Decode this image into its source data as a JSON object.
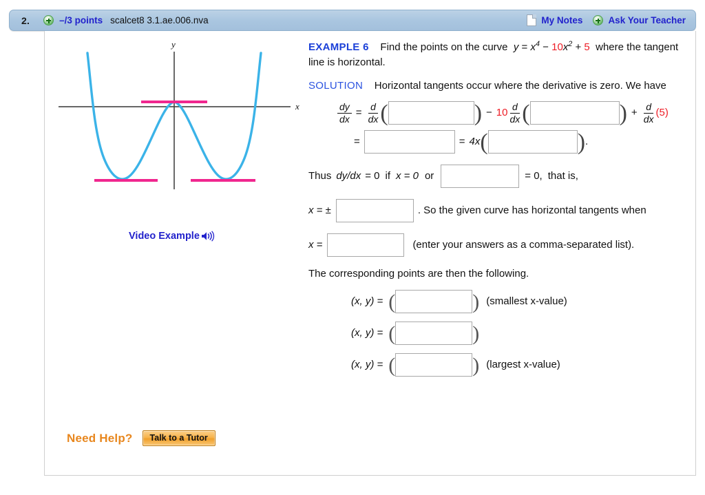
{
  "header": {
    "question_number": "2.",
    "add_icon": "plus-circle-icon",
    "points": "–/3 points",
    "assignment_id": "scalcet8 3.1.ae.006.nva",
    "notes_icon": "note-page-icon",
    "notes_label": "My Notes",
    "teacher_icon": "plus-circle-icon",
    "teacher_label": "Ask Your Teacher"
  },
  "graph": {
    "y_axis_label": "y",
    "x_axis_label": "x",
    "curve_color": "#3BB3E8",
    "tangent_color": "#F0278F",
    "axis_color": "#333333",
    "video_example_label": "Video Example",
    "speaker_icon": "speaker-sound-icon"
  },
  "problem": {
    "example_tag": "EXAMPLE 6",
    "statement_pre": "Find the points on the curve",
    "eq_y": "y",
    "eq_eq": "=",
    "eq_x": "x",
    "eq_pow4": "4",
    "eq_minus": "−",
    "eq_ten": "10",
    "eq_x2": "x",
    "eq_pow2": "2",
    "eq_plus": "+",
    "eq_five": "5",
    "statement_post": "where the tangent line is horizontal.",
    "solution_tag": "SOLUTION",
    "solution_text": "Horizontal tangents occur where the derivative is zero. We have"
  },
  "equation1": {
    "dy": "dy",
    "dx": "dx",
    "equals": "=",
    "d": "d",
    "d_dx": "dx",
    "open_paren": "(",
    "close_paren": ")",
    "minus": "−",
    "coefficient": "10",
    "plus": "+",
    "five_group": "(5)"
  },
  "equation2": {
    "equals1": "=",
    "equals2": "=",
    "four_x": "4x",
    "open_paren": "(",
    "close_paren": ")",
    "period": "."
  },
  "thus_line": {
    "thus": "Thus",
    "dydx": "dy/dx",
    "eq_zero": "= 0",
    "if": "if",
    "x_eq_zero": "x = 0",
    "or": "or",
    "eq_zero_after": "= 0,",
    "that_is": "that is,"
  },
  "pm_line": {
    "x_eq_pm": "x = ±",
    "after": ". So the given curve has horizontal tangents when"
  },
  "x_line": {
    "x_eq": "x =",
    "after": "(enter your answers as a comma-separated list)."
  },
  "points_intro": "The corresponding points are then the following.",
  "points_rows": [
    {
      "label": "(x, y)  =",
      "note": "(smallest x-value)"
    },
    {
      "label": "(x, y)  =",
      "note": ""
    },
    {
      "label": "(x, y)  =",
      "note": "(largest x-value)"
    }
  ],
  "help": {
    "label": "Need Help?",
    "button": "Talk to a Tutor"
  },
  "colors": {
    "header_blue": "#aac6e0",
    "link_blue": "#2222cc",
    "red": "#ee1c25",
    "orange": "#E8871E",
    "magenta": "#F0278F",
    "cyan": "#3BB3E8"
  }
}
